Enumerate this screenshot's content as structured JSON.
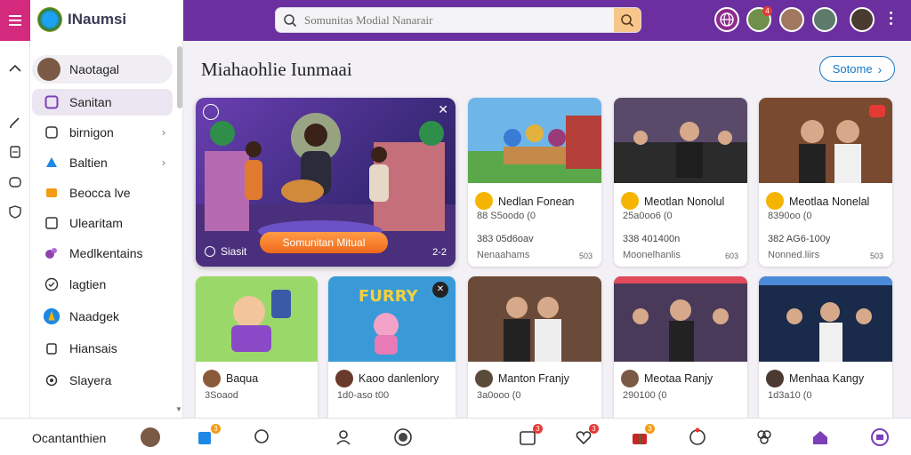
{
  "header": {
    "brand": "INaumsi",
    "search_placeholder": "Somunitas Modial Nanarair",
    "notification_count": "4"
  },
  "sidebar": {
    "profile_label": "Naotagal",
    "items": [
      {
        "label": "Sanitan",
        "icon": "square-icon",
        "active": true
      },
      {
        "label": "birnigon",
        "icon": "drop-icon",
        "chevron": true
      },
      {
        "label": "Baltien",
        "icon": "shape-icon",
        "chevron": true
      },
      {
        "label": "Beocca lve",
        "icon": "rocket-icon"
      },
      {
        "label": "Ulearitam",
        "icon": "grid-icon"
      },
      {
        "label": "Medlkentains",
        "icon": "puzzle-icon"
      },
      {
        "label": "lagtien",
        "icon": "check-circle-icon"
      },
      {
        "label": "Naadgek",
        "icon": "globe-icon"
      },
      {
        "label": "Hiansais",
        "icon": "bag-icon"
      },
      {
        "label": "Slayera",
        "icon": "gear-icon"
      }
    ]
  },
  "main": {
    "title": "Miahaohlie Iunmaai",
    "see_all": "Sotome"
  },
  "featured": {
    "cta": "Somunitan Mitual",
    "label": "Siasit",
    "count": "2-2"
  },
  "cards_row1": [
    {
      "title": "Nedlan Fonean",
      "meta": "88 S5oodo (0",
      "sub": "383 05d6oav",
      "foot": "Nenaahams",
      "num": "503"
    },
    {
      "title": "Meotlan Nonolul",
      "meta": "25a0oo6 (0",
      "sub": "338 401400n",
      "foot": "Moonelhanlis",
      "num": "603"
    },
    {
      "title": "Meotlaa Nonelal",
      "meta": "8390oo (0",
      "sub": "382 AG6-100y",
      "foot": "Nonned.liirs",
      "num": "503"
    }
  ],
  "cards_row2": [
    {
      "title": "Baqua",
      "meta": "3Soaod"
    },
    {
      "title": "Kaoo danlenlory",
      "meta": "1d0-aso t00"
    },
    {
      "title": "Manton Franjy",
      "meta": "3a0ooo (0"
    },
    {
      "title": "Meotaa Ranjy",
      "meta": "290100 (0"
    },
    {
      "title": "Menhaa Kangy",
      "meta": "1d3a10 (0"
    }
  ],
  "bottombar": {
    "label": "Ocantanthien",
    "badges": [
      "3",
      "3",
      "3",
      "3"
    ]
  },
  "colors": {
    "topbar": "#6b2fa0",
    "menu": "#d42a7e",
    "accent_blue": "#1877c9",
    "cta_orange": "#f06a1b"
  }
}
